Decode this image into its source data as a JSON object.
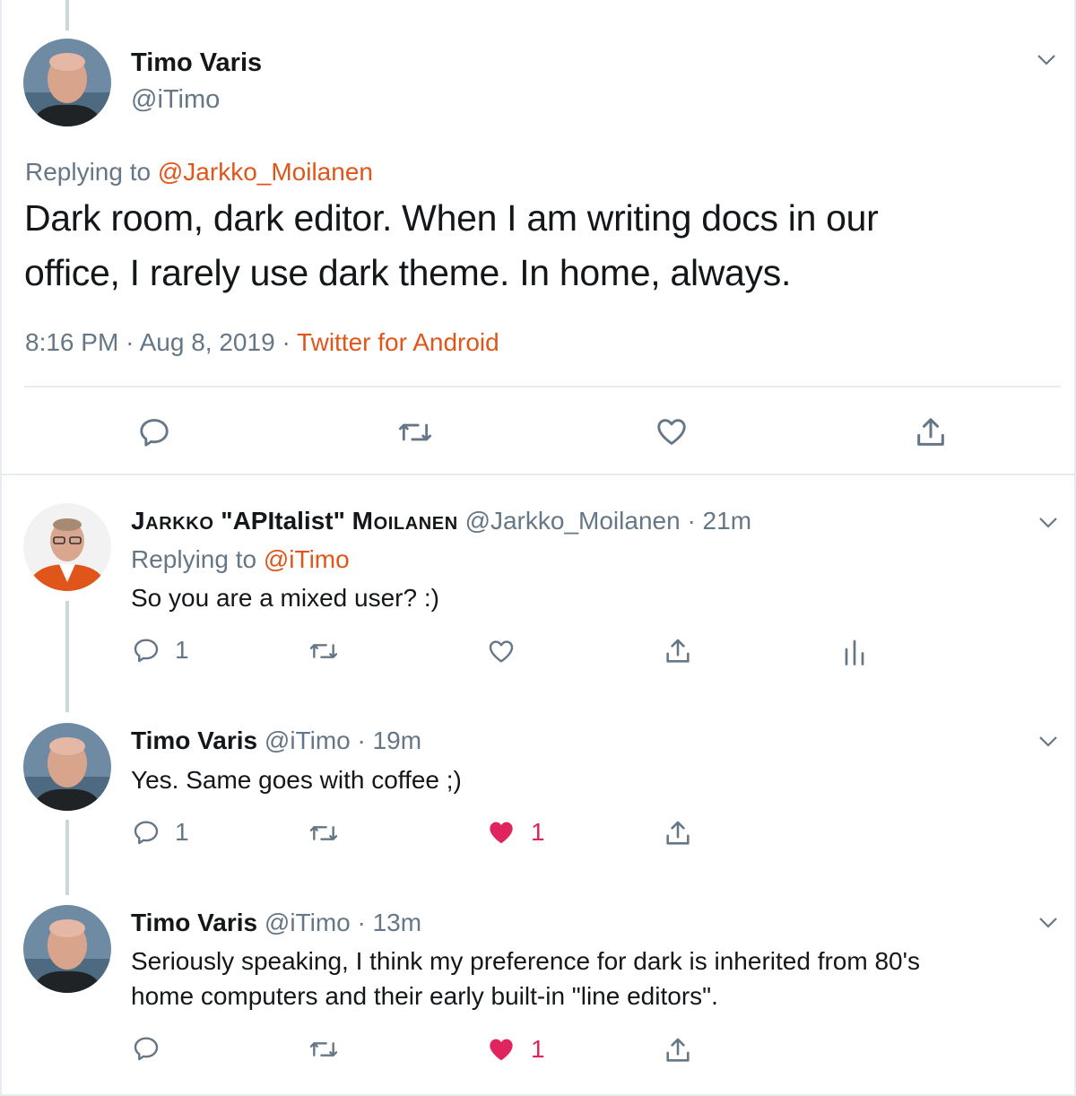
{
  "colors": {
    "accent": "#e0561a",
    "text": "#14171a",
    "muted": "#657786",
    "like": "#e0245e",
    "divider": "#e6ecf0"
  },
  "main_tweet": {
    "author_name": "Timo Varis",
    "author_handle": "@iTimo",
    "replying_to_label": "Replying to",
    "replying_to_handle": "@Jarkko_Moilanen",
    "text_line1": "Dark room, dark editor. When I am writing docs in our",
    "text_line2": "office, I rarely use dark theme. In home, always.",
    "time": "8:16 PM",
    "dot": "·",
    "date": "Aug 8, 2019",
    "source": "Twitter for Android",
    "icons": [
      "reply-icon",
      "retweet-icon",
      "like-icon",
      "share-icon"
    ]
  },
  "replies": [
    {
      "author_name": "JARKKO \"APItalist\" MOILANEN",
      "author_name_part1": "Jarkko",
      "author_name_part2": "\"APItalist\"",
      "author_name_part3": "Moilanen",
      "author_handle": "@Jarkko_Moilanen",
      "dot": "·",
      "time": "21m",
      "replying_to_label": "Replying to",
      "replying_to_handle": "@iTimo",
      "text": "So you are a mixed user? :)",
      "reply_count": "1",
      "like_count": "",
      "liked": false
    },
    {
      "author_name": "Timo Varis",
      "author_handle": "@iTimo",
      "dot": "·",
      "time": "19m",
      "text": "Yes. Same goes with coffee ;)",
      "reply_count": "1",
      "like_count": "1",
      "liked": true
    },
    {
      "author_name": "Timo Varis",
      "author_handle": "@iTimo",
      "dot": "·",
      "time": "13m",
      "text_line1": "Seriously speaking, I think my preference for dark is inherited from 80's",
      "text_line2": "home computers and their early built-in \"line editors\".",
      "reply_count": "",
      "like_count": "1",
      "liked": true
    }
  ]
}
